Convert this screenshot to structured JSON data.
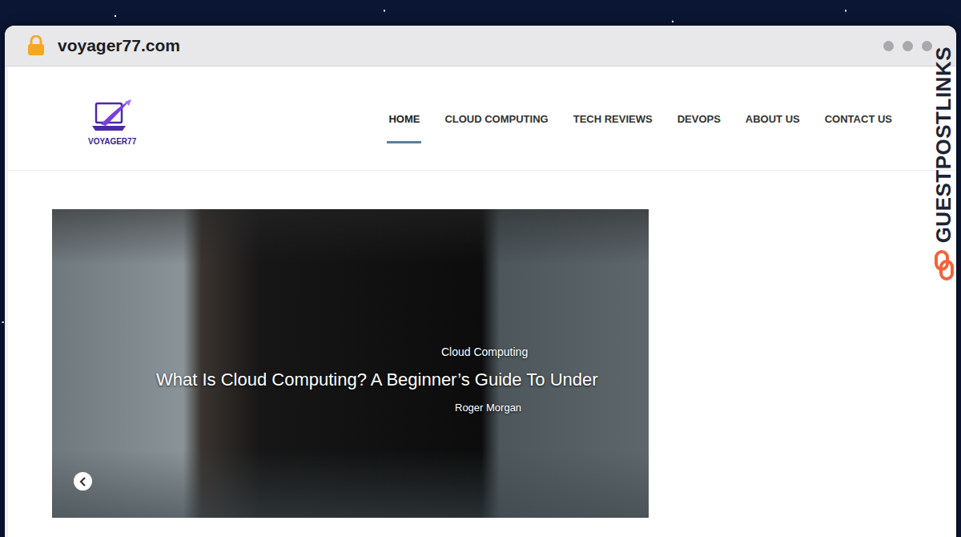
{
  "browser": {
    "url": "voyager77.com"
  },
  "site": {
    "logo": "VOYAGER77",
    "nav": [
      {
        "label": "HOME",
        "selected": true
      },
      {
        "label": "CLOUD COMPUTING",
        "selected": false
      },
      {
        "label": "TECH REVIEWS",
        "selected": false
      },
      {
        "label": "DEVOPS",
        "selected": false
      },
      {
        "label": "ABOUT US",
        "selected": false
      },
      {
        "label": "CONTACT US",
        "selected": false
      }
    ]
  },
  "hero": {
    "category": "Cloud Computing",
    "title": "What Is Cloud Computing? A Beginner’s Guide To Under",
    "author": "Roger Morgan"
  },
  "watermark": {
    "text": "GUESTPOSTLINKS"
  }
}
